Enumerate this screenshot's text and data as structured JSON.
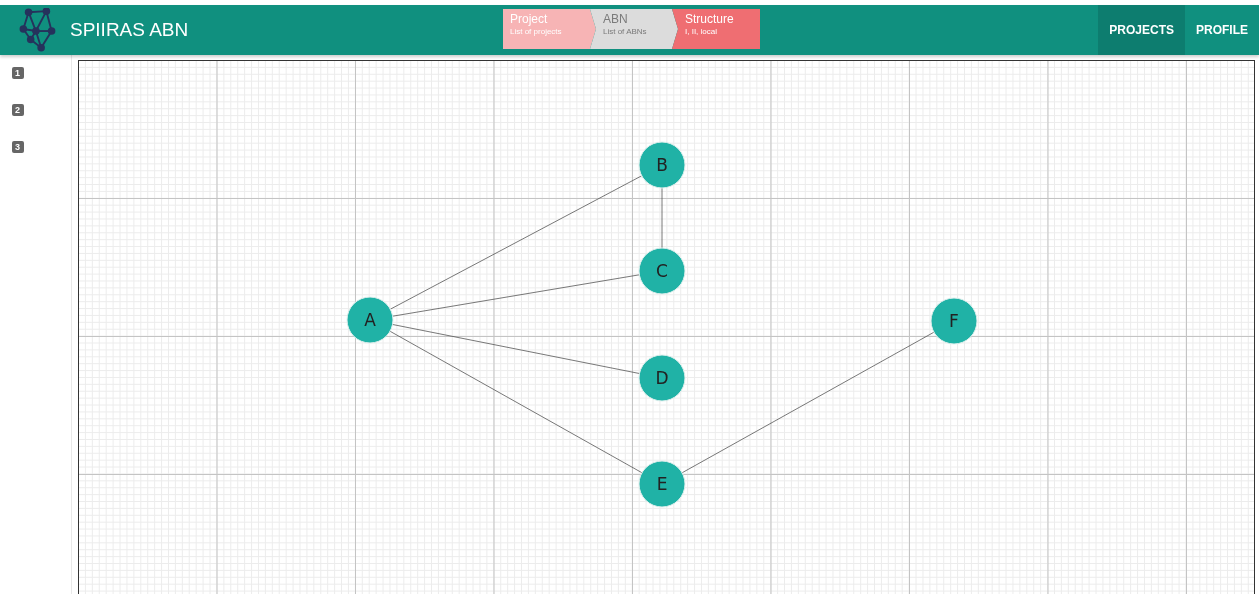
{
  "app": {
    "title": "SPIIRAS ABN"
  },
  "steps": [
    {
      "title": "Project",
      "subtitle": "List of projects",
      "kind": "done"
    },
    {
      "title": "ABN",
      "subtitle": "List of ABNs",
      "kind": "pending"
    },
    {
      "title": "Structure",
      "subtitle": "I, II, local",
      "kind": "current"
    }
  ],
  "nav": [
    {
      "label": "PROJECTS",
      "selected": true
    },
    {
      "label": "PROFILE",
      "selected": false
    }
  ],
  "sidebar": {
    "items": [
      "1",
      "2",
      "3"
    ]
  },
  "graph": {
    "nodes": [
      {
        "label": "A"
      },
      {
        "label": "B"
      },
      {
        "label": "C"
      },
      {
        "label": "D"
      },
      {
        "label": "E"
      },
      {
        "label": "F"
      }
    ]
  }
}
